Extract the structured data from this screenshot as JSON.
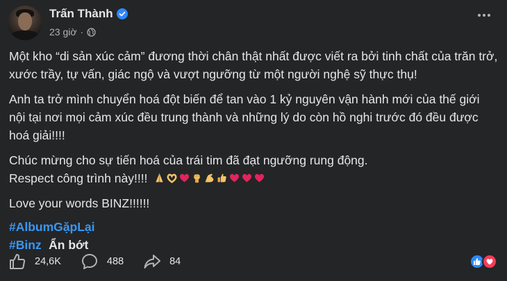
{
  "post": {
    "author": "Trấn Thành",
    "time": "23 giờ",
    "dot": "·",
    "paragraphs": [
      "Một kho “di sản xúc cảm” đương thời chân thật nhất được viết ra bởi tinh chất của trăn trở, xước trầy, tự vấn, giác ngộ và vượt ngưỡng từ một người nghệ sỹ thực thụ!",
      "Anh ta trở mình chuyển hoá đột biến để tan vào 1 kỷ nguyên vận hành mới của thế giới nội tại nơi mọi cảm xúc đều trung thành và những lý do còn hồ nghi trước đó đều được hoá giải!!!!"
    ],
    "para3_line1": "Chúc mừng cho sự tiến hoá của trái tim đã đạt ngưỡng rung động.",
    "para3_line2": "Respect công trình này!!!!",
    "emojis": [
      "folded-hands",
      "heart-hands",
      "red-heart",
      "raised-fist",
      "flexed-biceps",
      "thumbs-up",
      "red-heart",
      "red-heart",
      "red-heart"
    ],
    "para4": "Love your words BINZ!!!!!!",
    "hashtags": [
      "#AlbumGặpLại",
      "#Binz"
    ],
    "see_less": "Ẩn bớt"
  },
  "footer": {
    "likes": "24,6K",
    "comments": "488",
    "shares": "84"
  },
  "colors": {
    "background": "#242526",
    "text": "#e4e6eb",
    "muted": "#b0b3b8",
    "hashtag": "#3a97f2",
    "like": "#2d88ff",
    "love": "#f33e58"
  }
}
